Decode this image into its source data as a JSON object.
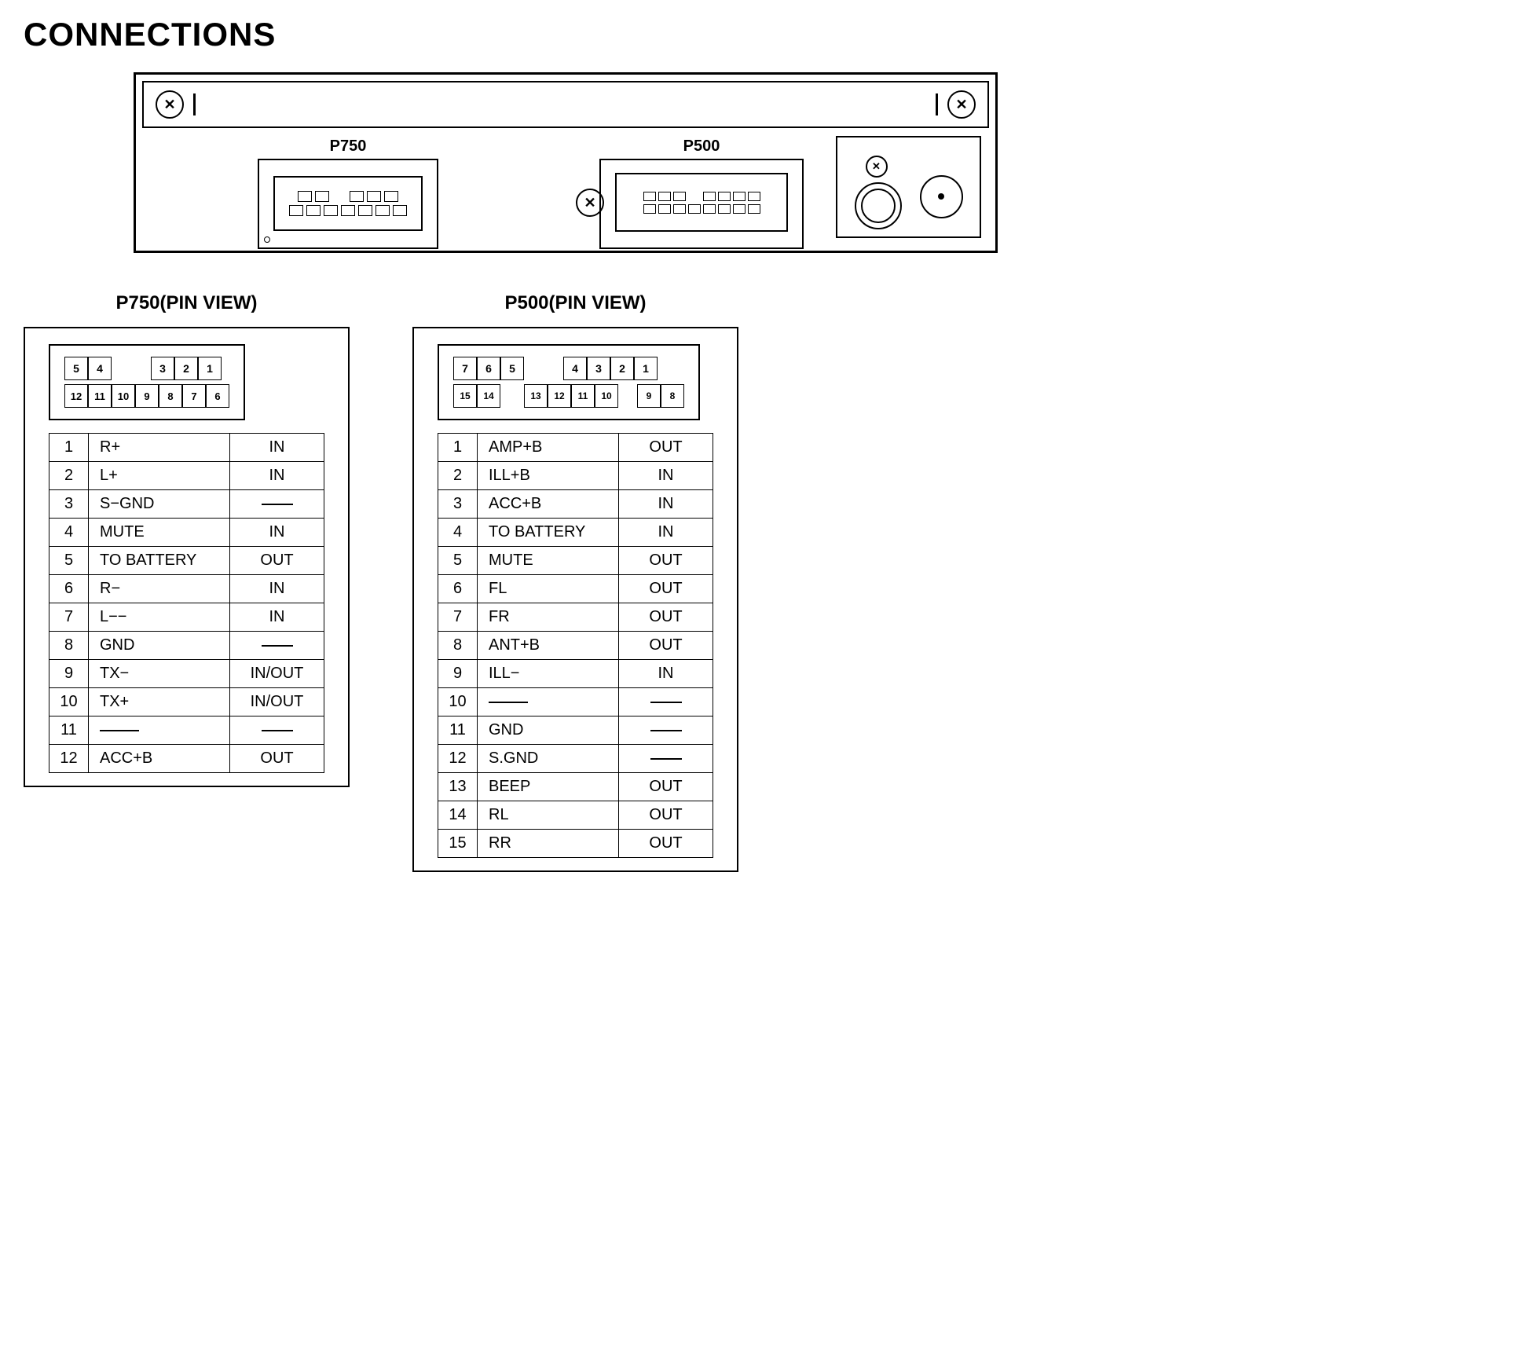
{
  "page": {
    "title": "CONNECTIONS"
  },
  "device": {
    "connector_left_label": "P750",
    "connector_right_label": "P500"
  },
  "p750_view": {
    "title": "P750(PIN VIEW)",
    "top_row": [
      "5",
      "4",
      "",
      "3",
      "2",
      "1"
    ],
    "bottom_row": [
      "12",
      "11",
      "10",
      "9",
      "8",
      "7",
      "6"
    ],
    "pins": [
      {
        "num": "1",
        "signal": "R+",
        "dir": "IN"
      },
      {
        "num": "2",
        "signal": "L+",
        "dir": "IN"
      },
      {
        "num": "3",
        "signal": "S−GND",
        "dir": "—"
      },
      {
        "num": "4",
        "signal": "MUTE",
        "dir": "IN"
      },
      {
        "num": "5",
        "signal": "TO BATTERY",
        "dir": "OUT"
      },
      {
        "num": "6",
        "signal": "R−",
        "dir": "IN"
      },
      {
        "num": "7",
        "signal": "L−−",
        "dir": "IN"
      },
      {
        "num": "8",
        "signal": "GND",
        "dir": "—"
      },
      {
        "num": "9",
        "signal": "TX−",
        "dir": "IN/OUT"
      },
      {
        "num": "10",
        "signal": "TX+",
        "dir": "IN/OUT"
      },
      {
        "num": "11",
        "signal": "—",
        "dir": "—"
      },
      {
        "num": "12",
        "signal": "ACC+B",
        "dir": "OUT"
      }
    ]
  },
  "p500_view": {
    "title": "P500(PIN VIEW)",
    "top_row": [
      "7",
      "6",
      "5",
      "",
      "4",
      "3",
      "2",
      "1"
    ],
    "bottom_row": [
      "15",
      "14",
      "",
      "13",
      "12",
      "11",
      "10",
      "",
      "9",
      "8"
    ],
    "pins": [
      {
        "num": "1",
        "signal": "AMP+B",
        "dir": "OUT"
      },
      {
        "num": "2",
        "signal": "ILL+B",
        "dir": "IN"
      },
      {
        "num": "3",
        "signal": "ACC+B",
        "dir": "IN"
      },
      {
        "num": "4",
        "signal": "TO BATTERY",
        "dir": "IN"
      },
      {
        "num": "5",
        "signal": "MUTE",
        "dir": "OUT"
      },
      {
        "num": "6",
        "signal": "FL",
        "dir": "OUT"
      },
      {
        "num": "7",
        "signal": "FR",
        "dir": "OUT"
      },
      {
        "num": "8",
        "signal": "ANT+B",
        "dir": "OUT"
      },
      {
        "num": "9",
        "signal": "ILL−",
        "dir": "IN"
      },
      {
        "num": "10",
        "signal": "—",
        "dir": "—"
      },
      {
        "num": "11",
        "signal": "GND",
        "dir": "—"
      },
      {
        "num": "12",
        "signal": "S.GND",
        "dir": "—"
      },
      {
        "num": "13",
        "signal": "BEEP",
        "dir": "OUT"
      },
      {
        "num": "14",
        "signal": "RL",
        "dir": "OUT"
      },
      {
        "num": "15",
        "signal": "RR",
        "dir": "OUT"
      }
    ]
  }
}
